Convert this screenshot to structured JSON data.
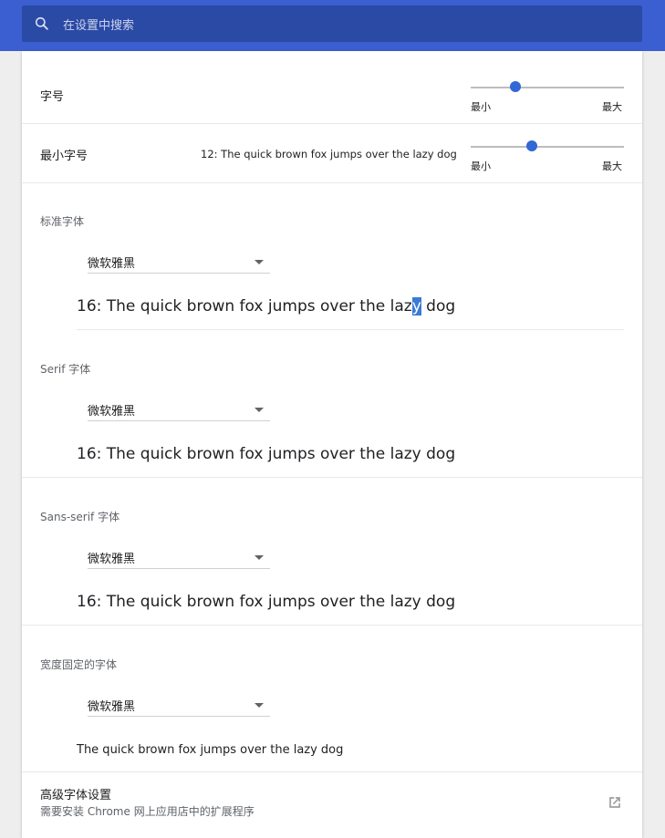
{
  "search": {
    "placeholder": "在设置中搜索",
    "icon": "search-icon"
  },
  "font_size": {
    "label": "字号",
    "min_label": "最小",
    "max_label": "最大",
    "level": 0.29
  },
  "min_font_size": {
    "label": "最小字号",
    "sample": "12: The quick brown fox jumps over the lazy dog",
    "min_label": "最小",
    "max_label": "最大",
    "level": 0.4
  },
  "standard_font": {
    "label": "标准字体",
    "value": "微软雅黑",
    "sample_before": "16: The quick brown fox jumps over the laz",
    "sample_selected": "y",
    "sample_after": " dog"
  },
  "serif_font": {
    "label": "Serif 字体",
    "value": "微软雅黑",
    "sample": "16: The quick brown fox jumps over the lazy dog"
  },
  "sans_serif_font": {
    "label": "Sans-serif 字体",
    "value": "微软雅黑",
    "sample": "16: The quick brown fox jumps over the lazy dog"
  },
  "fixed_width_font": {
    "label": "宽度固定的字体",
    "value": "微软雅黑",
    "sample": "The quick brown fox jumps over the lazy dog"
  },
  "advanced_fonts": {
    "title": "高级字体设置",
    "subtitle": "需要安装 Chrome 网上应用店中的扩展程序",
    "icon": "open-in-new-icon"
  },
  "colors": {
    "header": "#3b5fd0",
    "search_box": "#2b4aa6",
    "accent": "#3367d6"
  }
}
